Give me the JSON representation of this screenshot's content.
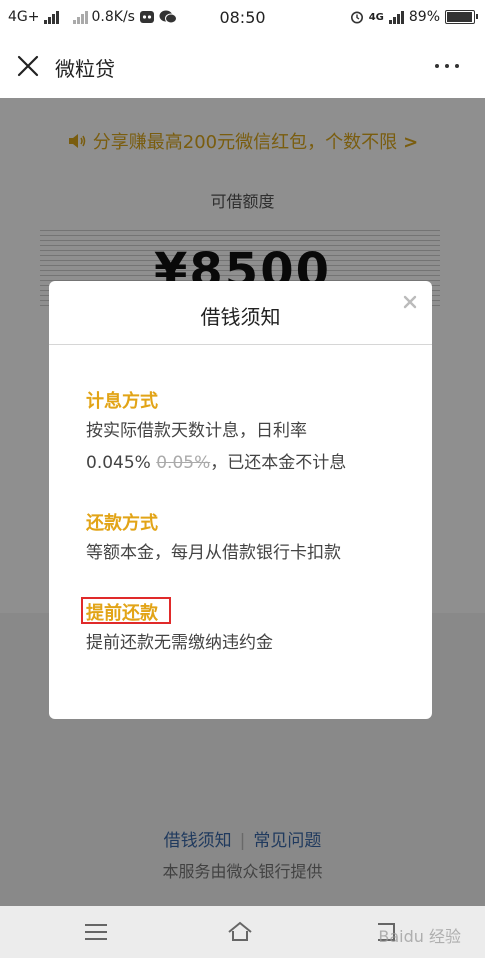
{
  "status_bar": {
    "network": "4G+",
    "speed": "0.8K/s",
    "time": "08:50",
    "signal_right": "4G",
    "battery_percent": "89%",
    "battery_level": 0.89
  },
  "nav": {
    "title": "微粒贷",
    "close_icon": "close-icon",
    "more_icon": "more-icon"
  },
  "page": {
    "share_banner": "分享赚最高200元微信红包，个数不限",
    "quota_label": "可借额度",
    "amount": "¥8500",
    "links": [
      "借钱须知",
      "常见问题"
    ],
    "footer_note": "本服务由微众银行提供"
  },
  "modal": {
    "title": "借钱须知",
    "sections": [
      {
        "title": "计息方式",
        "line1": "按实际借款天数计息，日利率",
        "rate": "0.045%",
        "old_rate": "0.05%",
        "line2_tail": "，已还本金不计息"
      },
      {
        "title": "还款方式",
        "text": "等额本金，每月从借款银行卡扣款"
      },
      {
        "title": "提前还款",
        "text": "提前还款无需缴纳违约金"
      }
    ]
  },
  "watermark": "Baidu 经验",
  "colors": {
    "accent": "#e2a417",
    "banner": "#d9a61c",
    "link": "#3a68a8",
    "highlight": "#e02a2a"
  }
}
